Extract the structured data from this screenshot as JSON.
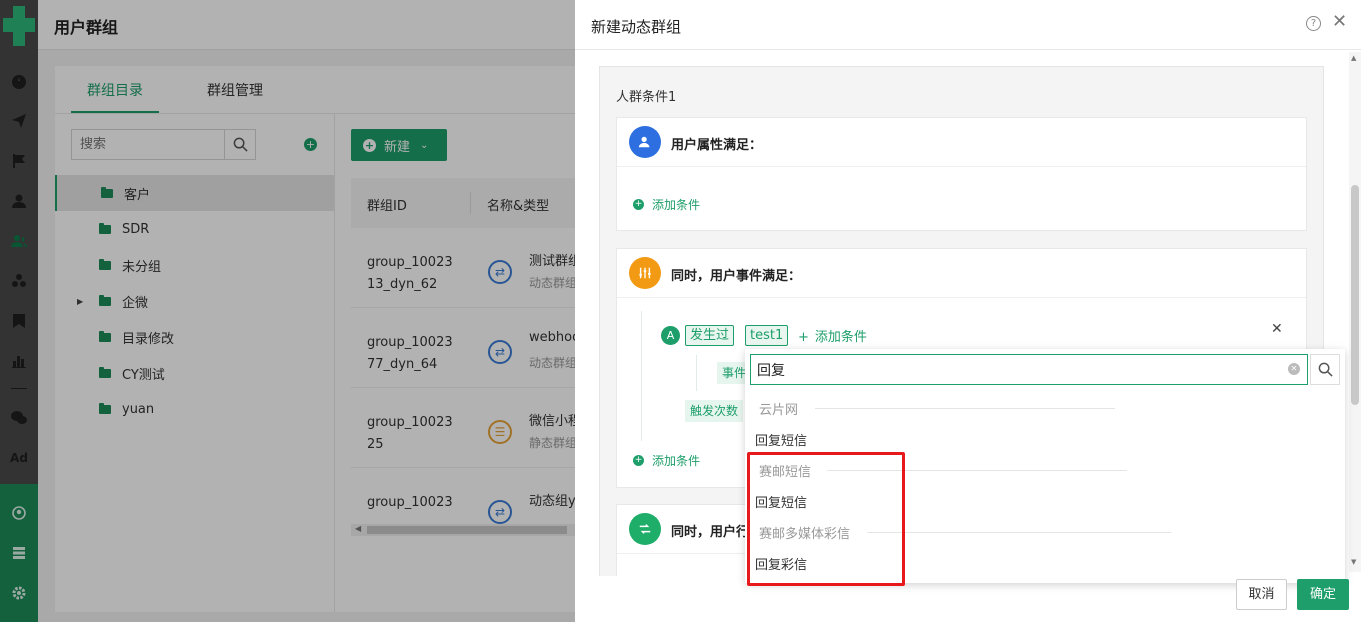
{
  "page": {
    "title": "用户群组",
    "tabs": [
      "群组目录",
      "群组管理"
    ],
    "search_placeholder": "搜索",
    "tree": [
      {
        "label": "客户",
        "selected": true,
        "expandable": false
      },
      {
        "label": "SDR",
        "selected": false,
        "expandable": false
      },
      {
        "label": "未分组",
        "selected": false,
        "expandable": false
      },
      {
        "label": "企微",
        "selected": false,
        "expandable": true
      },
      {
        "label": "目录修改",
        "selected": false,
        "expandable": false
      },
      {
        "label": "CY测试",
        "selected": false,
        "expandable": false
      },
      {
        "label": "yuan",
        "selected": false,
        "expandable": false
      }
    ],
    "new_button": "新建",
    "table": {
      "headers": [
        "群组ID",
        "名称&类型"
      ],
      "rows": [
        {
          "id_line1": "group_10023",
          "id_line2": "13_dyn_62",
          "name": "测试群组",
          "type": "动态群组",
          "icon": "sync-icon"
        },
        {
          "id_line1": "group_10023",
          "id_line2": "77_dyn_64",
          "name": "webhook",
          "type": "动态群组",
          "icon": "sync-icon"
        },
        {
          "id_line1": "group_10023",
          "id_line2": "25",
          "name": "微信小程序",
          "type": "静态群组",
          "icon": "list-icon"
        },
        {
          "id_line1": "group_10023",
          "id_line2": "",
          "name": "动态组y",
          "type": "",
          "icon": "sync-icon"
        }
      ]
    }
  },
  "drawer": {
    "title": "新建动态群组",
    "condition_label": "人群条件1",
    "section1_title": "用户属性满足：",
    "section2_title": "同时，用户事件满足：",
    "section3_title": "同时，用户行",
    "add_condition": "添加条件",
    "event": {
      "badge": "A",
      "tag_occurred": "发生过",
      "tag_event": "test1",
      "chip_event": "事件",
      "chip_trigger": "触发次数"
    },
    "cancel": "取消",
    "confirm": "确定"
  },
  "dropdown": {
    "query": "回复",
    "groups": [
      {
        "label": "云片网",
        "items": [
          "回复短信"
        ]
      },
      {
        "label": "赛邮短信",
        "items": [
          "回复短信"
        ]
      },
      {
        "label": "赛邮多媒体彩信",
        "items": [
          "回复彩信"
        ]
      }
    ]
  },
  "colors": {
    "brand": "#1e9e6a",
    "highlight": "#e8191b"
  }
}
